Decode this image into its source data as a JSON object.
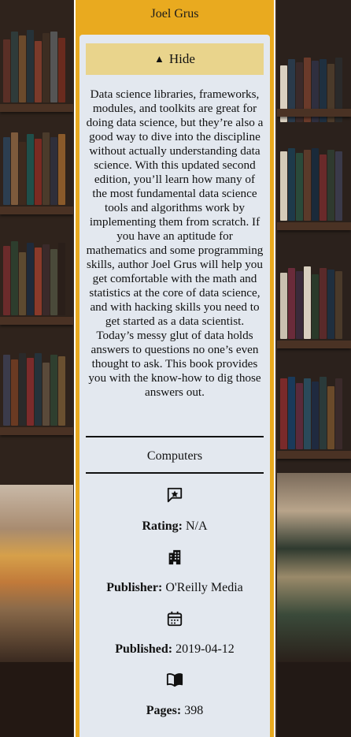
{
  "book": {
    "author": "Joel Grus",
    "toggle_label": "Hide",
    "toggle_icon": "triangle-up-icon",
    "description": "Data science libraries, frameworks, modules, and toolkits are great for doing data science, but they’re also a good way to dive into the discipline without actually understanding data science. With this updated second edition, you’ll learn how many of the most fundamental data science tools and algorithms work by implementing them from scratch. If you have an aptitude for mathematics and some programming skills, author Joel Grus will help you get comfortable with the math and statistics at the core of data science, and with hacking skills you need to get started as a data scientist. Today’s messy glut of data holds answers to questions no one’s even thought to ask. This book provides you with the know-how to dig those answers out.",
    "category": "Computers",
    "rating_label": "Rating:",
    "rating_value": "N/A",
    "publisher_label": "Publisher:",
    "publisher_value": "O'Reilly Media",
    "published_label": "Published:",
    "published_value": "2019-04-12",
    "pages_label": "Pages:",
    "pages_value": "398"
  },
  "icons": {
    "rating": "star-message-icon",
    "publisher": "building-icon",
    "published": "calendar-icon",
    "pages": "open-book-icon"
  },
  "colors": {
    "card_border": "#e9aa1f",
    "panel": "#e3e8ef",
    "toggle_bg": "#e9d48c"
  }
}
